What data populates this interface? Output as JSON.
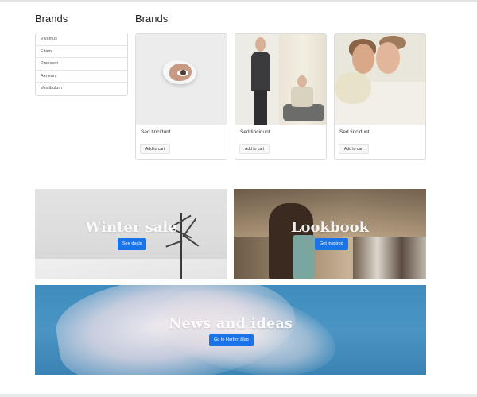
{
  "sidebar": {
    "title": "Brands",
    "items": [
      "Vivamus",
      "Etiam",
      "Praesent",
      "Aenean",
      "Vestibulum"
    ]
  },
  "main": {
    "title": "Brands",
    "cards": [
      {
        "title": "Sed tincidunt",
        "button": "Add to cart",
        "image": "torn-paper-eye-photo"
      },
      {
        "title": "Sed tincidunt",
        "button": "Add to cart",
        "image": "two-people-fashion-photo"
      },
      {
        "title": "Sed tincidunt",
        "button": "Add to cart",
        "image": "two-faces-portrait-photo"
      }
    ]
  },
  "banners": [
    {
      "title": "Winter sale",
      "button": "See deals",
      "image": "snowy-tree-photo"
    },
    {
      "title": "Lookbook",
      "button": "Get inspired",
      "image": "street-fashion-photo"
    },
    {
      "title": "News and ideas",
      "button": "Go to Harbor blog",
      "image": "plastic-bag-sky-photo"
    }
  ],
  "colors": {
    "primary_button": "#1a73e8",
    "banner_blue": "#4a95c4"
  }
}
